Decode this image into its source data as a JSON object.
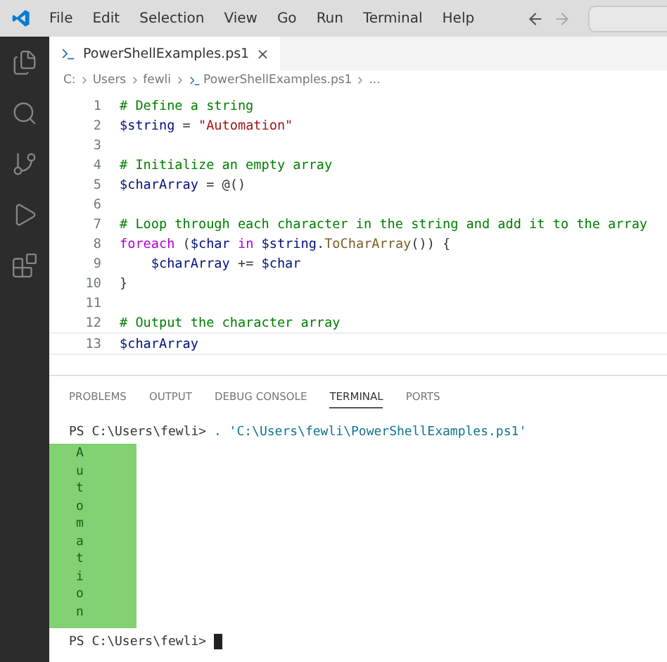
{
  "menu": [
    "File",
    "Edit",
    "Selection",
    "View",
    "Go",
    "Run",
    "Terminal",
    "Help"
  ],
  "activity_bar": [
    {
      "kind": "files",
      "selected": false
    },
    {
      "kind": "search",
      "selected": false
    },
    {
      "kind": "source-control",
      "selected": false
    },
    {
      "kind": "run",
      "selected": false
    },
    {
      "kind": "extensions",
      "selected": false
    }
  ],
  "tab": {
    "label": "PowerShellExamples.ps1",
    "close": "×"
  },
  "breadcrumb": [
    "C:",
    "Users",
    "fewli",
    "PowerShellExamples.ps1",
    "..."
  ],
  "code_lines": [
    {
      "number": "1",
      "tokens": [
        {
          "kind": "comment",
          "text": "# Define a string"
        }
      ]
    },
    {
      "number": "2",
      "tokens": [
        {
          "kind": "variable",
          "text": "$string"
        },
        {
          "kind": "plain",
          "text": " = "
        },
        {
          "kind": "string",
          "text": "\"Automation\""
        }
      ]
    },
    {
      "number": "3"
    },
    {
      "number": "4",
      "tokens": [
        {
          "kind": "comment",
          "text": "# Initialize an empty array"
        }
      ]
    },
    {
      "number": "5",
      "tokens": [
        {
          "kind": "variable",
          "text": "$charArray"
        },
        {
          "kind": "plain",
          "text": " = @()"
        }
      ]
    },
    {
      "number": "6"
    },
    {
      "number": "7",
      "tokens": [
        {
          "kind": "comment",
          "text": "# Loop through each character in the string and add it to the array"
        }
      ]
    },
    {
      "number": "8",
      "tokens": [
        {
          "kind": "keyword",
          "text": "foreach"
        },
        {
          "kind": "plain",
          "text": " ("
        },
        {
          "kind": "variable",
          "text": "$char"
        },
        {
          "kind": "keyword",
          "text": " in "
        },
        {
          "kind": "variable",
          "text": "$string"
        },
        {
          "kind": "plain",
          "text": "."
        },
        {
          "kind": "method",
          "text": "ToCharArray"
        },
        {
          "kind": "plain",
          "text": "()) {"
        }
      ]
    },
    {
      "number": "9",
      "tokens": [
        {
          "kind": "variable",
          "text": "    $charArray"
        },
        {
          "kind": "plain",
          "text": " += "
        },
        {
          "kind": "variable",
          "text": "$char"
        }
      ]
    },
    {
      "number": "10",
      "tokens": [
        {
          "kind": "plain",
          "text": "}"
        }
      ]
    },
    {
      "number": "11"
    },
    {
      "number": "12",
      "tokens": [
        {
          "kind": "comment",
          "text": "# Output the character array"
        }
      ]
    },
    {
      "number": "13",
      "tokens": [
        {
          "kind": "variable",
          "text": "$charArray"
        }
      ]
    }
  ],
  "panel_tabs": [
    {
      "label": "PROBLEMS",
      "selected": false
    },
    {
      "label": "OUTPUT",
      "selected": false
    },
    {
      "label": "DEBUG CONSOLE",
      "selected": false
    },
    {
      "label": "TERMINAL",
      "selected": true
    },
    {
      "label": "PORTS",
      "selected": false
    }
  ],
  "terminal": {
    "command_prompt": "PS C:\\Users\\fewli> ",
    "command": ". 'C:\\Users\\fewli\\PowerShellExamples.ps1'",
    "output_highlighted": true,
    "output": [
      "A",
      "u",
      "t",
      "o",
      "m",
      "a",
      "t",
      "i",
      "o",
      "n"
    ],
    "final_prompt": "PS C:\\Users\\fewli> "
  }
}
